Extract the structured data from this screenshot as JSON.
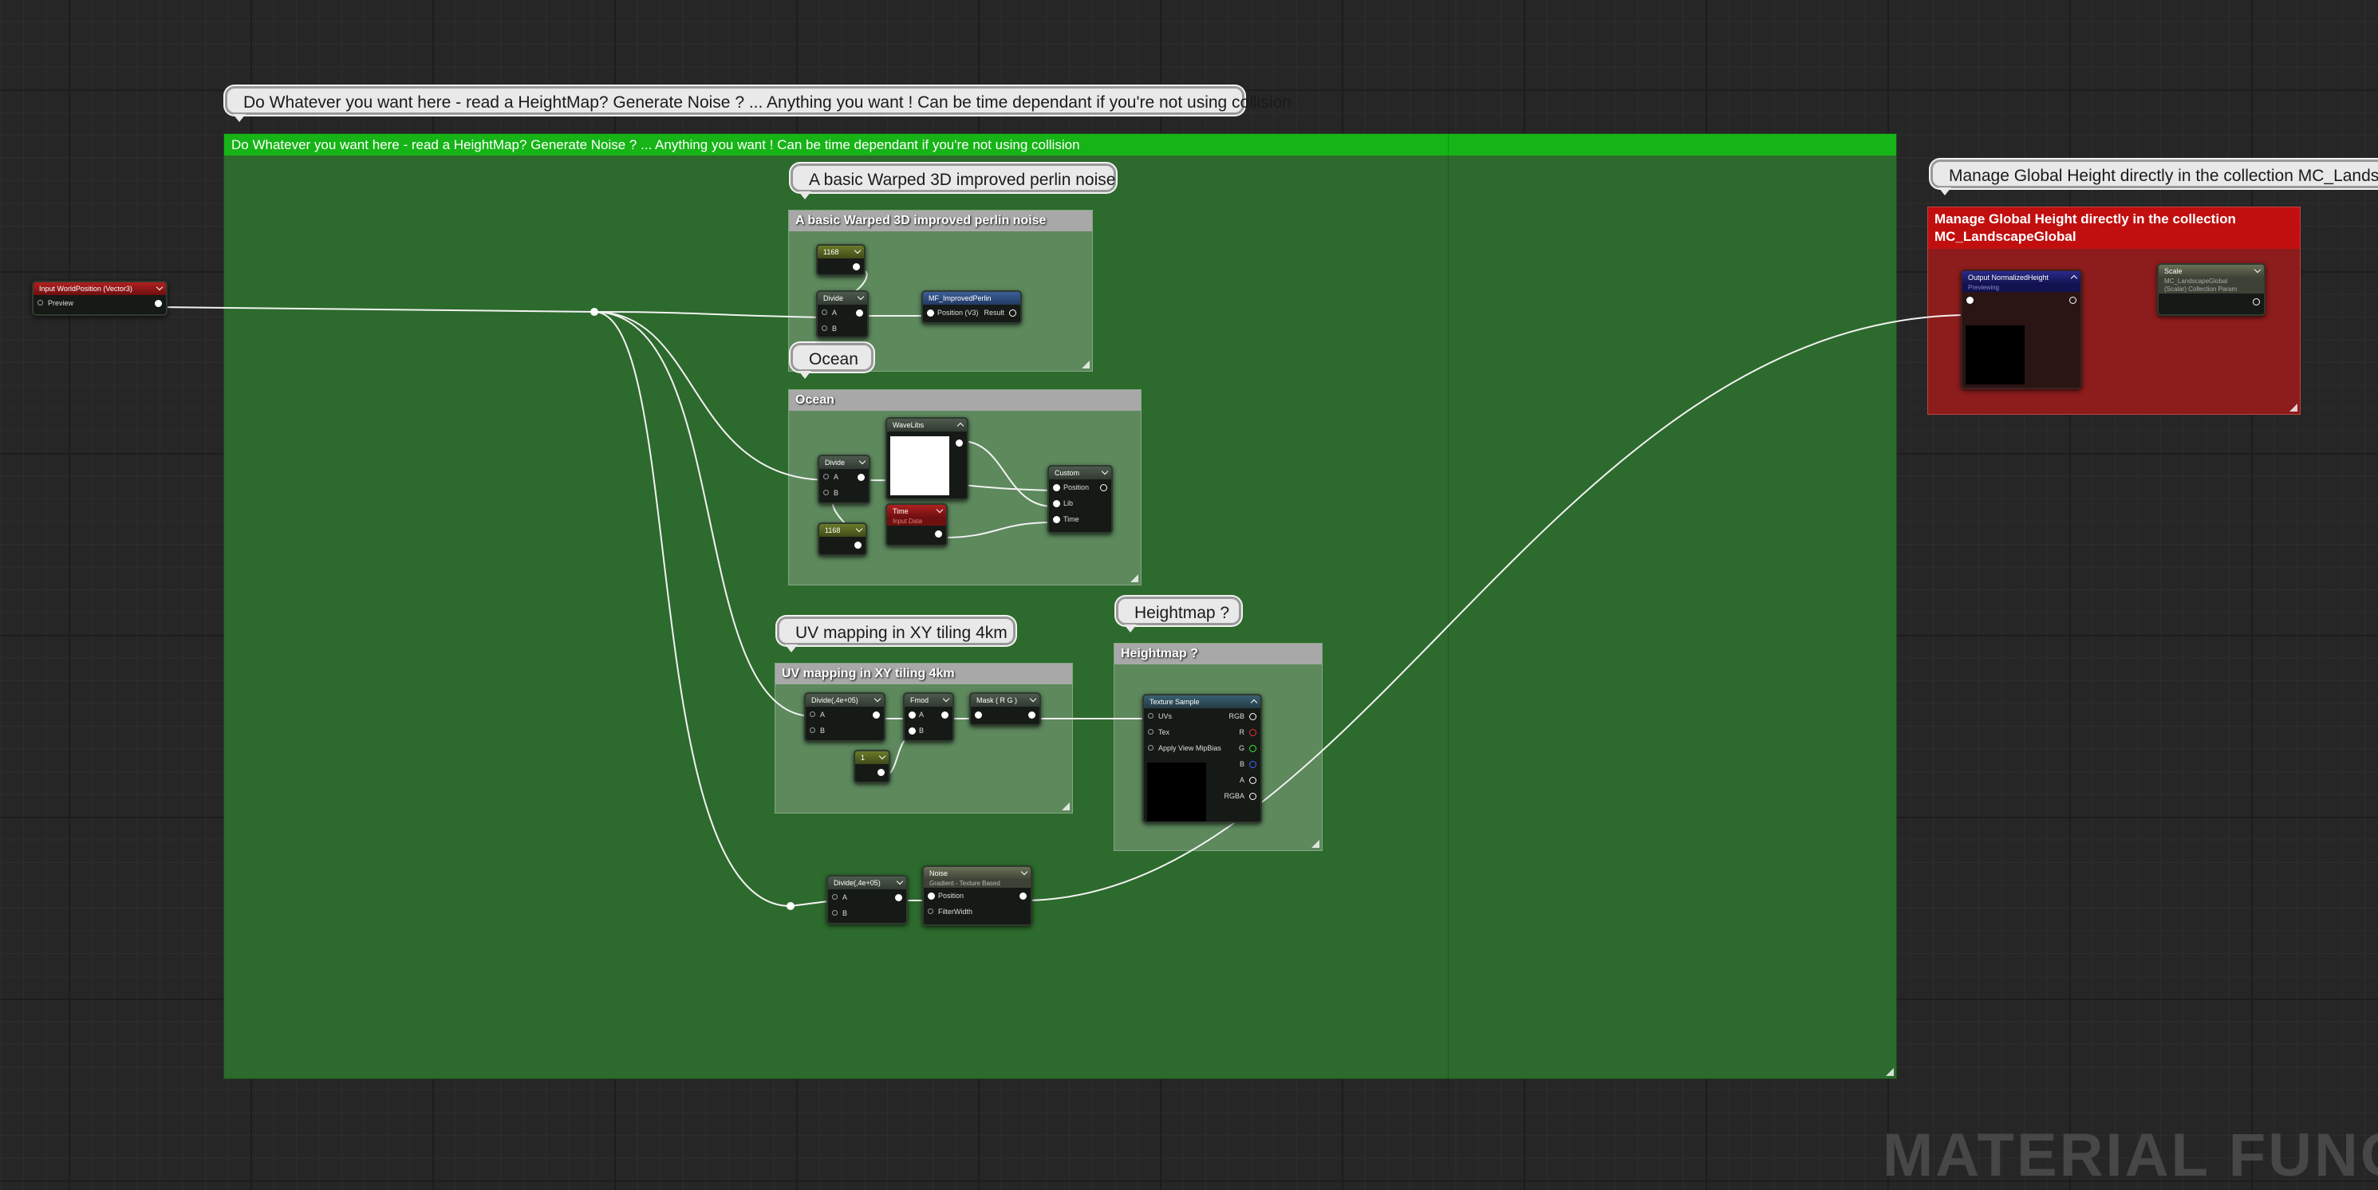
{
  "comments": {
    "main_bubble": "Do Whatever you want here - read a HeightMap? Generate Noise ? ... Anything you want ! Can be time dependant if you're not using collision",
    "main_title": "Do Whatever you want here - read a HeightMap? Generate Noise ? ... Anything you want ! Can be time dependant if you're not using collision",
    "perlin_bubble": "A basic Warped 3D improved perlin noise",
    "perlin_title": "A basic Warped 3D improved perlin noise",
    "ocean_bubble": "Ocean",
    "ocean_title": "Ocean",
    "uv_bubble": "UV mapping in XY tiling 4km",
    "uv_title": "UV mapping in XY tiling 4km",
    "heightmap_bubble": "Heightmap ?",
    "heightmap_title": "Heightmap ?",
    "global_bubble": "Manage Global Height directly in the collection MC_LandscapeGlobal",
    "global_title": "Manage Global Height directly in the collection MC_LandscapeGlobal"
  },
  "nodes": {
    "input_world_position": {
      "title": "Input WorldPosition (Vector3)",
      "pin": "Preview"
    },
    "perlin_const": {
      "title": "1168"
    },
    "perlin_divide": {
      "title": "Divide",
      "pin_a": "A",
      "pin_b": "B"
    },
    "improved_perlin": {
      "title": "MF_ImprovedPerlin",
      "pin": "Position (V3)",
      "out": "Result"
    },
    "ocean_divide": {
      "title": "Divide",
      "pin_a": "A",
      "pin_b": "B"
    },
    "wave_lib": {
      "title": "WaveLibs"
    },
    "ocean_const": {
      "title": "1168"
    },
    "time": {
      "title": "Time",
      "sub": "Input Data"
    },
    "custom": {
      "title": "Custom",
      "pin_position": "Position",
      "pin_lib": "Lib",
      "pin_time": "Time"
    },
    "uv_divide": {
      "title": "Divide(,4e+05)",
      "pin_a": "A",
      "pin_b": "B"
    },
    "uv_fmod": {
      "title": "Fmod",
      "pin_a": "A",
      "pin_b": "B"
    },
    "uv_mask": {
      "title": "Mask ( R G )"
    },
    "uv_const": {
      "title": "1"
    },
    "texture_sample": {
      "title": "Texture Sample",
      "pin_uvs": "UVs",
      "pin_tex": "Tex",
      "pin_mip": "Apply View MipBias",
      "out_rgb": "RGB",
      "out_r": "R",
      "out_g": "G",
      "out_b": "B",
      "out_a": "A",
      "out_rgba": "RGBA"
    },
    "noise_divide": {
      "title": "Divide(,4e+05)",
      "pin_a": "A",
      "pin_b": "B"
    },
    "noise": {
      "title": "Noise",
      "sub": "Gradient - Texture Based",
      "pin_position": "Position",
      "pin_filter": "FilterWidth"
    },
    "output_height": {
      "title": "Output NormalizedHeight",
      "sub": "Previewing"
    },
    "scale": {
      "title": "Scale",
      "sub": "MC_LandscapeGlobal",
      "sub2": "(Scalar) Collection Param"
    }
  },
  "watermark": "MATERIAL FUNC",
  "colors": {
    "background": "#262626",
    "main_comment": "#2e6b2e",
    "main_comment_header": "#17b517",
    "global_comment": "#8e1b1b",
    "global_comment_header": "#c41010"
  }
}
